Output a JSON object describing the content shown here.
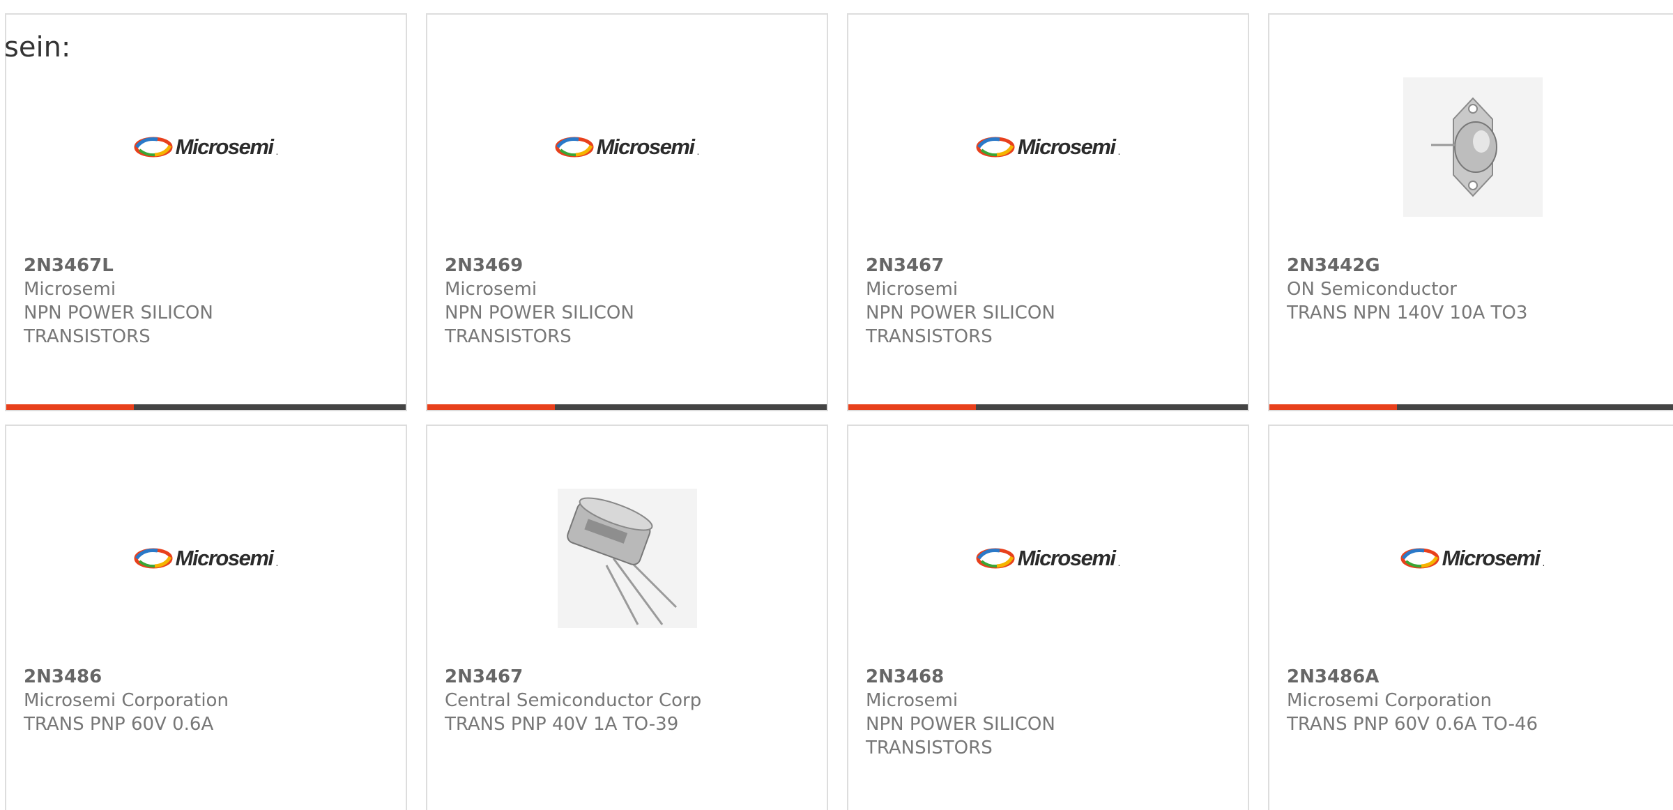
{
  "intro_text": "sein:",
  "brand_logo_text": "Microsemi",
  "colors": {
    "accent": "#e8401c",
    "bar_dark": "#444444",
    "border": "#dddddd",
    "text": "#777777"
  },
  "products": [
    {
      "part_number": "2N3467L",
      "manufacturer": "Microsemi",
      "description": "NPN POWER SILICON TRANSISTORS",
      "image": "microsemi-logo"
    },
    {
      "part_number": "2N3469",
      "manufacturer": "Microsemi",
      "description": "NPN POWER SILICON TRANSISTORS",
      "image": "microsemi-logo"
    },
    {
      "part_number": "2N3467",
      "manufacturer": "Microsemi",
      "description": "NPN POWER SILICON TRANSISTORS",
      "image": "microsemi-logo"
    },
    {
      "part_number": "2N3442G",
      "manufacturer": "ON Semiconductor",
      "description": "TRANS NPN 140V 10A TO3",
      "image": "to3-transistor-photo"
    },
    {
      "part_number": "2N3486",
      "manufacturer": "Microsemi Corporation",
      "description": "TRANS PNP 60V 0.6A",
      "image": "microsemi-logo"
    },
    {
      "part_number": "2N3467",
      "manufacturer": "Central Semiconductor Corp",
      "description": "TRANS PNP 40V 1A TO-39",
      "image": "to39-transistor-photo"
    },
    {
      "part_number": "2N3468",
      "manufacturer": "Microsemi",
      "description": "NPN POWER SILICON TRANSISTORS",
      "image": "microsemi-logo"
    },
    {
      "part_number": "2N3486A",
      "manufacturer": "Microsemi Corporation",
      "description": "TRANS PNP 60V 0.6A TO-46",
      "image": "microsemi-logo"
    }
  ]
}
